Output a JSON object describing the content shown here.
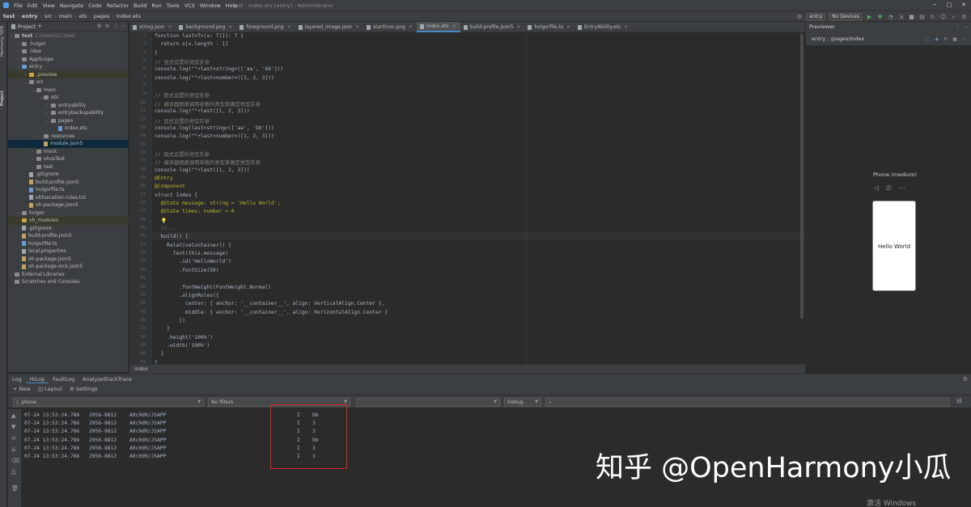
{
  "menubar": {
    "items": [
      "File",
      "Edit",
      "View",
      "Navigate",
      "Code",
      "Refactor",
      "Build",
      "Run",
      "Tools",
      "VCS",
      "Window",
      "Help"
    ],
    "window_title": "test - Index.ets [entry] - Administrator",
    "minimize": "─",
    "maximize": "□",
    "close": "✕"
  },
  "navbar": {
    "crumbs": [
      "test",
      "entry",
      "src",
      "main",
      "ets",
      "pages",
      "Index.ets"
    ],
    "run_config": "entry",
    "device": "No Devices"
  },
  "left_strip": {
    "tabs": [
      "Project",
      "Harmony SDK"
    ]
  },
  "project": {
    "title": "Project",
    "tree": [
      {
        "label": "test",
        "path": "C:\\Users\\CC\\test",
        "depth": 0,
        "arrow": "v",
        "icon": "folder"
      },
      {
        "label": ".hvigor",
        "depth": 1,
        "arrow": ">",
        "icon": "folder"
      },
      {
        "label": ".idea",
        "depth": 1,
        "arrow": ">",
        "icon": "folder"
      },
      {
        "label": "AppScope",
        "depth": 1,
        "arrow": ">",
        "icon": "folder"
      },
      {
        "label": "entry",
        "depth": 1,
        "arrow": "v",
        "icon": "folder-b"
      },
      {
        "label": ".preview",
        "depth": 2,
        "arrow": ">",
        "icon": "folder-y",
        "state": "hl"
      },
      {
        "label": "src",
        "depth": 2,
        "arrow": "v",
        "icon": "folder"
      },
      {
        "label": "main",
        "depth": 3,
        "arrow": "v",
        "icon": "folder"
      },
      {
        "label": "ets",
        "depth": 4,
        "arrow": "v",
        "icon": "folder"
      },
      {
        "label": "entryability",
        "depth": 5,
        "arrow": ">",
        "icon": "folder"
      },
      {
        "label": "entrybackupability",
        "depth": 5,
        "arrow": ">",
        "icon": "folder"
      },
      {
        "label": "pages",
        "depth": 5,
        "arrow": "v",
        "icon": "folder"
      },
      {
        "label": "Index.ets",
        "depth": 6,
        "arrow": "",
        "icon": "file-t"
      },
      {
        "label": "resources",
        "depth": 4,
        "arrow": ">",
        "icon": "folder"
      },
      {
        "label": "module.json5",
        "depth": 4,
        "arrow": "",
        "icon": "file-j",
        "state": "sel"
      },
      {
        "label": "mock",
        "depth": 3,
        "arrow": ">",
        "icon": "folder"
      },
      {
        "label": "ohosTest",
        "depth": 3,
        "arrow": ">",
        "icon": "folder"
      },
      {
        "label": "test",
        "depth": 3,
        "arrow": ">",
        "icon": "folder"
      },
      {
        "label": ".gitignore",
        "depth": 2,
        "arrow": "",
        "icon": "file"
      },
      {
        "label": "build-profile.json5",
        "depth": 2,
        "arrow": "",
        "icon": "file-j"
      },
      {
        "label": "hvigorfile.ts",
        "depth": 2,
        "arrow": "",
        "icon": "file-t"
      },
      {
        "label": "obfuscation-rules.txt",
        "depth": 2,
        "arrow": "",
        "icon": "file"
      },
      {
        "label": "oh-package.json5",
        "depth": 2,
        "arrow": "",
        "icon": "file-j"
      },
      {
        "label": "hvigor",
        "depth": 1,
        "arrow": ">",
        "icon": "folder"
      },
      {
        "label": "oh_modules",
        "depth": 1,
        "arrow": ">",
        "icon": "folder-y",
        "state": "hl"
      },
      {
        "label": ".gitignore",
        "depth": 1,
        "arrow": "",
        "icon": "file"
      },
      {
        "label": "build-profile.json5",
        "depth": 1,
        "arrow": "",
        "icon": "file-j"
      },
      {
        "label": "hvigorfile.ts",
        "depth": 1,
        "arrow": "",
        "icon": "file-t"
      },
      {
        "label": "local.properties",
        "depth": 1,
        "arrow": "",
        "icon": "file"
      },
      {
        "label": "oh-package.json5",
        "depth": 1,
        "arrow": "",
        "icon": "file-j"
      },
      {
        "label": "oh-package-lock.json5",
        "depth": 1,
        "arrow": "",
        "icon": "file-j"
      },
      {
        "label": "External Libraries",
        "depth": 0,
        "arrow": ">",
        "icon": "folder"
      },
      {
        "label": "Scratches and Consoles",
        "depth": 0,
        "arrow": "",
        "icon": "folder"
      }
    ]
  },
  "tabs": [
    {
      "label": "string.json",
      "active": false
    },
    {
      "label": "background.png",
      "active": false
    },
    {
      "label": "foreground.png",
      "active": false
    },
    {
      "label": "layered_image.json",
      "active": false
    },
    {
      "label": "startIcon.png",
      "active": false
    },
    {
      "label": "Index.ets",
      "active": true
    },
    {
      "label": "build-profile.json5",
      "active": false
    },
    {
      "label": "hvigorfile.ts",
      "active": false
    },
    {
      "label": "EntryAbility.ets",
      "active": false
    }
  ],
  "editor": {
    "line_numbers": [
      "2",
      "3",
      "4",
      "5",
      "6",
      "7",
      "8",
      "9",
      "10",
      "11",
      "12",
      "13",
      "14",
      "15",
      "16",
      "17",
      "18",
      "19",
      "20",
      "21",
      "22",
      "23",
      "24",
      "25",
      "26",
      "27",
      "28",
      "29",
      "30",
      "31",
      "32",
      "33",
      "34",
      "35",
      "36",
      "37",
      "38",
      "39",
      "40",
      "41",
      "42"
    ],
    "lines": [
      "function last<T>(x: T[]): T {",
      "  return x[x.length - 1]",
      "}",
      "// 显式设置的类型实参",
      "console.log(\"\"+last<string>(['aa', 'bb']))",
      "console.log(\"\"+last<number>([1, 2, 3]))",
      "",
      "// 隐式设置的类型实参",
      "// 编译器根据调用参数的类型来确定类型实参",
      "console.log(\"\"+last([1, 2, 3]))",
      "// 显式设置的类型实参",
      "console.log(last<string>(['aa', 'bb']))",
      "console.log(\"\"+last<number>([1, 2, 3]))",
      "",
      "// 隐式设置的类型实参",
      "// 编译器根据调用参数的类型来确定类型实参",
      "console.log(\"\"+last([1, 2, 3]))",
      "@Entry",
      "@Component",
      "struct Index {",
      "  @State message: string = 'Hello World';",
      "  @State times: number = 0",
      "  💡",
      "  //...",
      "  build() {",
      "    RelativeContainer() {",
      "      Text(this.message)",
      "        .id('HelloWorld')",
      "        .fontSize(50)",
      "",
      "        .fontWeight(FontWeight.Normal)",
      "        .alignRules({",
      "          center: { anchor: '__container__', align: VerticalAlign.Center },",
      "          middle: { anchor: '__container__', align: HorizontalAlign.Center }",
      "        })",
      "    }",
      "    .height('100%')",
      "    .width('100%')",
      "  }",
      "}",
      ""
    ],
    "footer": "Index"
  },
  "previewer": {
    "title": "Previewer",
    "route": "entry : /pages/Index",
    "device_label": "Phone (medium)",
    "phone_text": "Hello World"
  },
  "bottom_tabs": [
    "Log",
    "HiLog",
    "FaultLog",
    "AnalyzeStackTrace"
  ],
  "hilog_toolbar": {
    "new": "New",
    "layout": "Layout",
    "settings": "Settings"
  },
  "filters": {
    "device": "phone",
    "process": "No filters",
    "level": "Debug",
    "search": ""
  },
  "log": {
    "rows": [
      {
        "time": "07-24 13:53:24.786",
        "pid": "2956-8812",
        "tag": "A0c0d0/JSAPP",
        "level": "I",
        "msg": "bb"
      },
      {
        "time": "07-24 13:53:24.786",
        "pid": "2956-8812",
        "tag": "A0c0d0/JSAPP",
        "level": "I",
        "msg": "3"
      },
      {
        "time": "07-24 13:53:24.786",
        "pid": "2956-8812",
        "tag": "A0c0d0/JSAPP",
        "level": "I",
        "msg": "3"
      },
      {
        "time": "07-24 13:53:24.786",
        "pid": "2956-8812",
        "tag": "A0c0d0/JSAPP",
        "level": "I",
        "msg": "bb"
      },
      {
        "time": "07-24 13:53:24.786",
        "pid": "2956-8812",
        "tag": "A0c0d0/JSAPP",
        "level": "I",
        "msg": "3"
      },
      {
        "time": "07-24 13:53:24.786",
        "pid": "2956-8812",
        "tag": "A0c0d0/JSAPP",
        "level": "I",
        "msg": "3"
      }
    ]
  },
  "overlay": {
    "watermark": "知乎 @OpenHarmony小瓜",
    "activate": "激活 Windows"
  },
  "colors": {
    "accent": "#4a88c7",
    "highlight_box": "#e02020",
    "selection": "#0d293e"
  }
}
